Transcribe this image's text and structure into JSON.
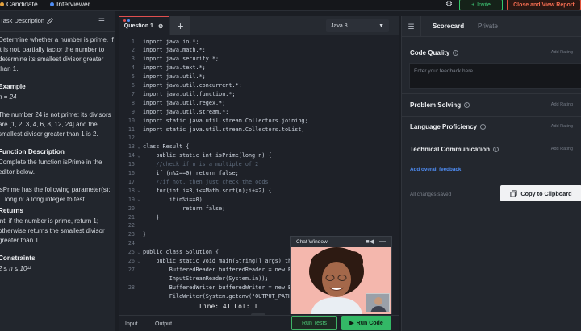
{
  "topbar": {
    "candidate_label": "Candidate",
    "interviewer_label": "Interviewer",
    "invite_label": "Invite",
    "close_label": "Close and View Report",
    "colors": {
      "candidate": "#e6a23c",
      "interviewer": "#4f8ef7",
      "invite": "#41d07a",
      "close": "#f26b50"
    }
  },
  "task": {
    "header": "Task Description",
    "intro": "Determine whether a number is prime. If it is not, partially factor the number to determine its smallest divisor greater than 1.",
    "example_heading": "Example",
    "example_n": "n = 24",
    "example_text": "The number 24 is not prime: its divisors are [1, 2, 3, 4, 6, 8, 12, 24] and the smallest divisor greater than 1 is 2.",
    "func_heading": "Function Description",
    "func_text": "Complete the function isPrime in the editor below.",
    "params_text": "isPrime has the following parameter(s):",
    "param_long": "long n:  a long integer to test",
    "returns_heading": "Returns",
    "returns_text": "int: if the number is prime, return 1; otherwise returns the smallest divisor greater than 1",
    "constraints_heading": "Constraints",
    "constraints_text": "2 ≤ n ≤ 10¹²"
  },
  "editor": {
    "tab_label": "Question 1",
    "language": "Java 8",
    "status": "Line: 41 Col: 1",
    "lines": [
      {
        "n": "1",
        "text": "import java.io.*;"
      },
      {
        "n": "2",
        "text": "import java.math.*;"
      },
      {
        "n": "3",
        "text": "import java.security.*;"
      },
      {
        "n": "4",
        "text": "import java.text.*;"
      },
      {
        "n": "5",
        "text": "import java.util.*;"
      },
      {
        "n": "6",
        "text": "import java.util.concurrent.*;"
      },
      {
        "n": "7",
        "text": "import java.util.function.*;"
      },
      {
        "n": "8",
        "text": "import java.util.regex.*;"
      },
      {
        "n": "9",
        "text": "import java.util.stream.*;"
      },
      {
        "n": "10",
        "text": "import static java.util.stream.Collectors.joining;"
      },
      {
        "n": "11",
        "text": "import static java.util.stream.Collectors.toList;"
      },
      {
        "n": "12",
        "text": ""
      },
      {
        "n": "13",
        "text": "class Result {"
      },
      {
        "n": "14",
        "text": "    public static int isPrime(long n) {"
      },
      {
        "n": "15",
        "text": "    //check if n is a multiple of 2"
      },
      {
        "n": "16",
        "text": "    if (n%2==0) return false;"
      },
      {
        "n": "17",
        "text": "    //if not, then just check the odds"
      },
      {
        "n": "18",
        "text": "    for(int i=3;i<=Math.sqrt(n);i+=2) {"
      },
      {
        "n": "19",
        "text": "        if(n%i==0)"
      },
      {
        "n": "20",
        "text": "            return false;"
      },
      {
        "n": "21",
        "text": "    }"
      },
      {
        "n": "22",
        "text": ""
      },
      {
        "n": "23",
        "text": "}"
      },
      {
        "n": "24",
        "text": ""
      },
      {
        "n": "25",
        "text": "public class Solution {"
      },
      {
        "n": "26",
        "text": "    public static void main(String[] args) throws IOException {"
      },
      {
        "n": "27",
        "text": "        BufferedReader bufferedReader = new BufferedReader(new"
      },
      {
        "n": "",
        "text": "        InputStreamReader(System.in));"
      },
      {
        "n": "28",
        "text": "        BufferedWriter bufferedWriter = new BufferedWriter(new"
      },
      {
        "n": "",
        "text": "        FileWriter(System.getenv(\"OUTPUT_PATH\")));"
      }
    ],
    "input_tab": "Input",
    "output_tab": "Output",
    "run_tests_label": "Run Tests",
    "run_code_label": "Run Code"
  },
  "chat": {
    "title": "Chat Window"
  },
  "scorecard": {
    "tab_scorecard": "Scorecard",
    "tab_private": "Private",
    "add_rating": "Add Rating",
    "code_quality": "Code Quality",
    "feedback_placeholder": "Enter your feedback here",
    "problem_solving": "Problem Solving",
    "language_proficiency": "Language Proficiency",
    "technical_communication": "Technical Communication",
    "add_overall_feedback": "Add overall feedback",
    "all_changes_saved": "All changes saved",
    "copy_label": "Copy to Clipboard"
  }
}
